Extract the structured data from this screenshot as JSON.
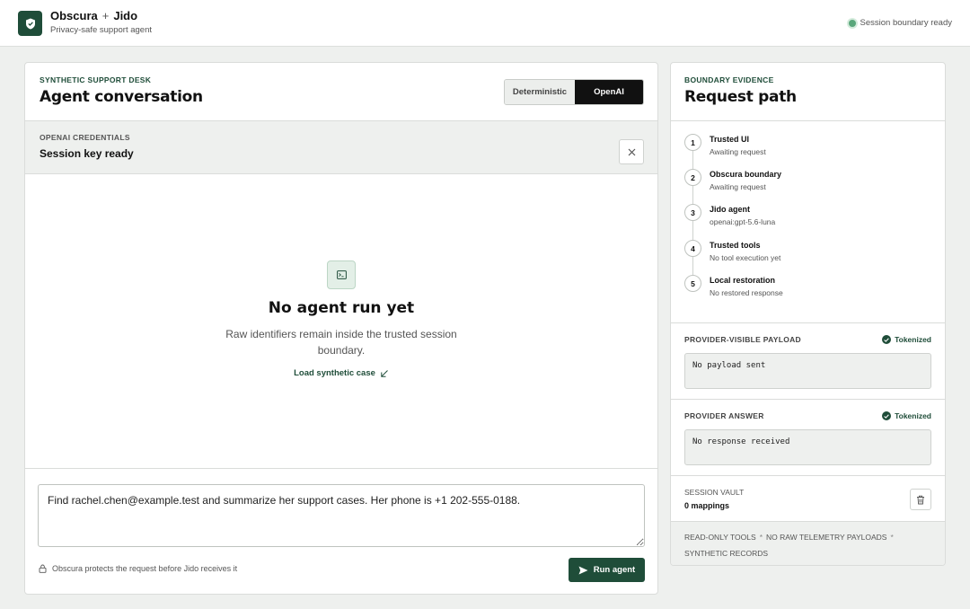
{
  "header": {
    "brand_a": "Obscura",
    "plus": "+",
    "brand_b": "Jido",
    "subtitle": "Privacy-safe support agent",
    "status": "Session boundary ready"
  },
  "conversation": {
    "eyebrow": "SYNTHETIC SUPPORT DESK",
    "title": "Agent conversation",
    "modes": [
      "Deterministic",
      "OpenAI"
    ],
    "active_mode": "OpenAI"
  },
  "credentials": {
    "label": "OPENAI CREDENTIALS",
    "value": "Session key ready"
  },
  "empty_state": {
    "title": "No agent run yet",
    "text": "Raw identifiers remain inside the trusted session boundary.",
    "link": "Load synthetic case"
  },
  "composer": {
    "prompt": "Find rachel.chen@example.test and summarize her support cases. Her phone is +1 202-555-0188.",
    "note": "Obscura protects the request before Jido receives it",
    "run_label": "Run agent"
  },
  "evidence": {
    "eyebrow": "BOUNDARY EVIDENCE",
    "title": "Request path",
    "steps": [
      {
        "num": "1",
        "title": "Trusted UI",
        "sub": "Awaiting request"
      },
      {
        "num": "2",
        "title": "Obscura boundary",
        "sub": "Awaiting request"
      },
      {
        "num": "3",
        "title": "Jido agent",
        "sub": "openai:gpt-5.6-luna"
      },
      {
        "num": "4",
        "title": "Trusted tools",
        "sub": "No tool execution yet"
      },
      {
        "num": "5",
        "title": "Local restoration",
        "sub": "No restored response"
      }
    ],
    "payload": {
      "label": "PROVIDER-VISIBLE PAYLOAD",
      "badge": "Tokenized",
      "value": "No payload sent"
    },
    "answer": {
      "label": "PROVIDER ANSWER",
      "badge": "Tokenized",
      "value": "No response received"
    },
    "vault": {
      "label": "SESSION VAULT",
      "value": "0 mappings"
    },
    "tags": [
      "READ-ONLY TOOLS",
      "NO RAW TELEMETRY PAYLOADS",
      "SYNTHETIC RECORDS"
    ],
    "tag_separator": "*"
  },
  "colors": {
    "brand": "#1f4d39",
    "status_dot": "#5aa77c",
    "background": "#eef0ee"
  }
}
